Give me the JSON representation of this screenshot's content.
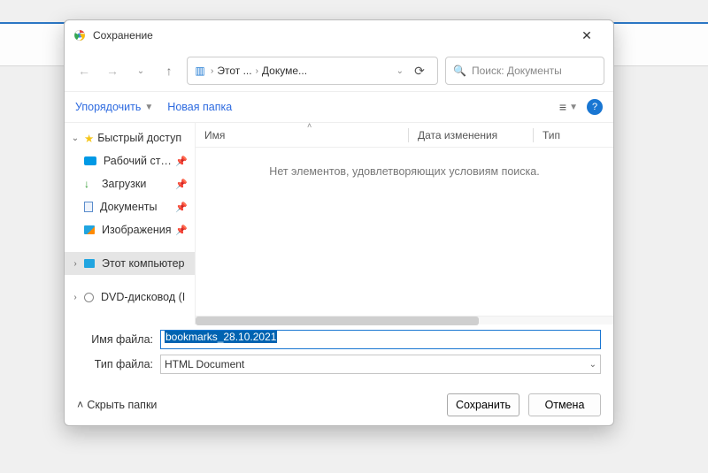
{
  "title": "Сохранение",
  "breadcrumb": {
    "root": "Этот ...",
    "leaf": "Докуме..."
  },
  "search": {
    "placeholder": "Поиск: Документы"
  },
  "toolbar": {
    "organize": "Упорядочить",
    "newfolder": "Новая папка"
  },
  "columns": {
    "name": "Имя",
    "date": "Дата изменения",
    "type": "Тип"
  },
  "empty_msg": "Нет элементов, удовлетворяющих условиям поиска.",
  "sidebar": {
    "quick": "Быстрый доступ",
    "desktop": "Рабочий стол",
    "downloads": "Загрузки",
    "documents": "Документы",
    "images": "Изображения",
    "thispc": "Этот компьютер",
    "dvd": "DVD-дисковод (I"
  },
  "labels": {
    "filename": "Имя файла:",
    "filetype": "Тип файла:"
  },
  "filename_value": "bookmarks_28.10.2021",
  "filetype_value": "HTML Document",
  "footer": {
    "hide": "Скрыть папки",
    "save": "Сохранить",
    "cancel": "Отмена"
  }
}
